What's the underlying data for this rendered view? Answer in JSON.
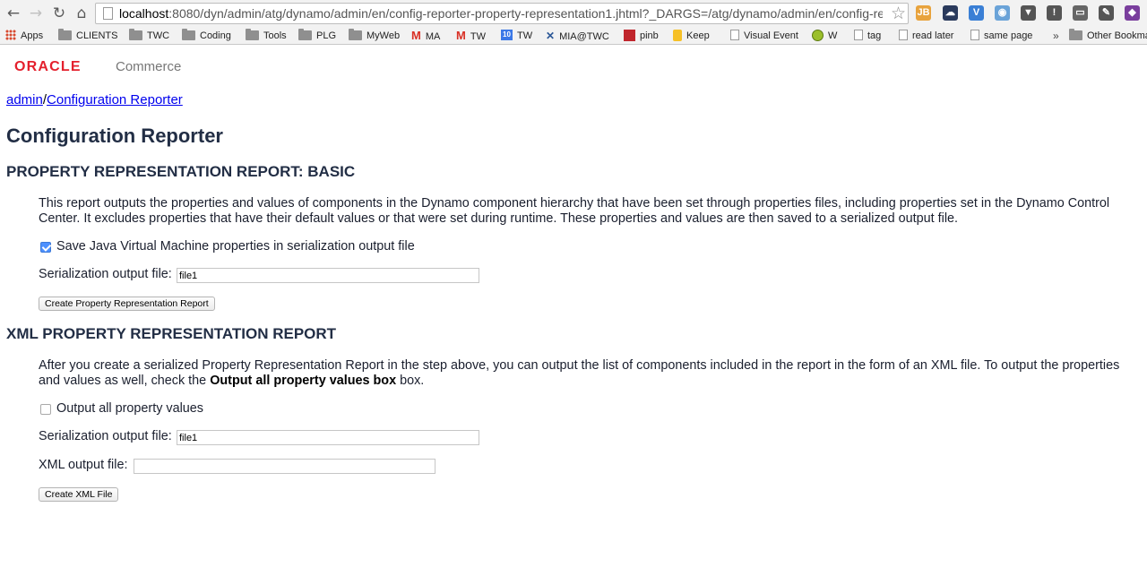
{
  "browser": {
    "url_host": "localhost",
    "url_rest": ":8080/dyn/admin/atg/dynamo/admin/en/config-reporter-property-representation1.jhtml?_DARGS=/atg/dynamo/admin/en/config-reporter...",
    "back_glyph": "←",
    "forward_glyph": "→",
    "reload_glyph": "↻",
    "home_glyph": "⌂",
    "star_glyph": "☆",
    "extensions": [
      {
        "icon": "jb-icon",
        "text": "JB",
        "color": "#e8a33d"
      },
      {
        "icon": "cloud-icon",
        "text": "☁",
        "color": "#2a3a5c"
      },
      {
        "icon": "v-icon",
        "text": "V",
        "color": "#3a7fd5"
      },
      {
        "icon": "camera-icon",
        "text": "◉",
        "color": "#6aa3d8"
      },
      {
        "icon": "pocket-icon",
        "text": "▼",
        "color": "#555555"
      },
      {
        "icon": "info-icon",
        "text": "!",
        "color": "#555555"
      },
      {
        "icon": "cast-icon",
        "text": "▭",
        "color": "#666666"
      },
      {
        "icon": "evernote-icon",
        "text": "✎",
        "color": "#555555"
      },
      {
        "icon": "profile-icon",
        "text": "◆",
        "color": "#7a3e9d"
      }
    ]
  },
  "bookmarks": [
    {
      "label": "Apps",
      "icon": "apps-icon"
    },
    {
      "label": "CLIENTS",
      "icon": "folder-icon"
    },
    {
      "label": "TWC",
      "icon": "folder-icon"
    },
    {
      "label": "Coding",
      "icon": "folder-icon"
    },
    {
      "label": "Tools",
      "icon": "folder-icon"
    },
    {
      "label": "PLG",
      "icon": "folder-icon"
    },
    {
      "label": "MyWeb",
      "icon": "folder-icon"
    },
    {
      "label": "MA",
      "icon": "gmail-icon"
    },
    {
      "label": "TW",
      "icon": "gmail-icon"
    },
    {
      "label": "TW",
      "icon": "calendar-icon",
      "icon_text": "10"
    },
    {
      "label": "MIA@TWC",
      "icon": "x-icon"
    },
    {
      "label": "pinb",
      "icon": "pinboard-icon"
    },
    {
      "label": "Keep",
      "icon": "keep-icon"
    },
    {
      "label": "Visual Event",
      "icon": "page-icon"
    },
    {
      "label": "W",
      "icon": "ball-icon"
    },
    {
      "label": "tag",
      "icon": "page-icon"
    },
    {
      "label": "read later",
      "icon": "page-icon"
    },
    {
      "label": "same page",
      "icon": "page-icon"
    },
    {
      "label": "»",
      "icon": "chevron-icon"
    },
    {
      "label": "Other Bookmarks",
      "icon": "folder-icon"
    }
  ],
  "header": {
    "brand": "ORACLE",
    "product": "Commerce"
  },
  "breadcrumb": {
    "root": "admin",
    "separator": "/",
    "current": "Configuration Reporter"
  },
  "page_title": "Configuration Reporter",
  "basic_section": {
    "heading": "PROPERTY REPRESENTATION REPORT: BASIC",
    "description": "This report outputs the properties and values of components in the Dynamo component hierarchy that have been set through properties files, including properties set in the Dynamo Control Center. It excludes properties that have their default values or that were set during runtime. These properties and values are then saved to a serialized output file.",
    "save_jvm_label": "Save Java Virtual Machine properties in serialization output file",
    "save_jvm_checked": true,
    "serialization_label": "Serialization output file:",
    "serialization_value": "file1",
    "create_button": "Create Property Representation Report"
  },
  "xml_section": {
    "heading": "XML PROPERTY REPRESENTATION REPORT",
    "description_pre": "After you create a serialized Property Representation Report in the step above, you can output the list of components included in the report in the form of an XML file. To output the properties and values as well, check the ",
    "description_bold": "Output all property values box",
    "description_post": " box.",
    "output_all_label": "Output all property values",
    "output_all_checked": false,
    "serialization_label": "Serialization output file:",
    "serialization_value": "file1",
    "xml_label": "XML output file:",
    "xml_value": "",
    "create_button": "Create XML File"
  }
}
